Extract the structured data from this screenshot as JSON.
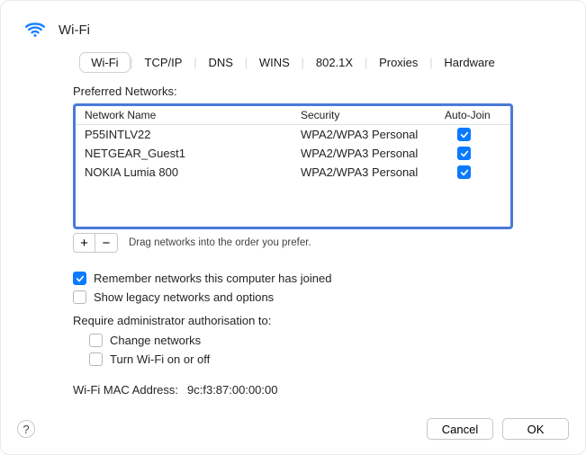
{
  "title": "Wi-Fi",
  "tabs": [
    "Wi-Fi",
    "TCP/IP",
    "DNS",
    "WINS",
    "802.1X",
    "Proxies",
    "Hardware"
  ],
  "selected_tab_index": 0,
  "preferred_label": "Preferred Networks:",
  "columns": {
    "name": "Network Name",
    "security": "Security",
    "auto_join": "Auto-Join"
  },
  "networks": [
    {
      "name": "P55INTLV22",
      "security": "WPA2/WPA3 Personal",
      "auto_join": true
    },
    {
      "name": "NETGEAR_Guest1",
      "security": "WPA2/WPA3 Personal",
      "auto_join": true
    },
    {
      "name": "NOKIA Lumia 800",
      "security": "WPA2/WPA3 Personal",
      "auto_join": true
    }
  ],
  "drag_hint": "Drag networks into the order you prefer.",
  "options": {
    "remember": {
      "label": "Remember networks this computer has joined",
      "checked": true
    },
    "show_legacy": {
      "label": "Show legacy networks and options",
      "checked": false
    }
  },
  "admin": {
    "title": "Require administrator authorisation to:",
    "change_networks": {
      "label": "Change networks",
      "checked": false
    },
    "turn_wifi": {
      "label": "Turn Wi-Fi on or off",
      "checked": false
    }
  },
  "mac": {
    "label": "Wi-Fi MAC Address:",
    "value": "9c:f3:87:00:00:00"
  },
  "buttons": {
    "add": "+",
    "remove": "−",
    "help": "?",
    "cancel": "Cancel",
    "ok": "OK"
  }
}
